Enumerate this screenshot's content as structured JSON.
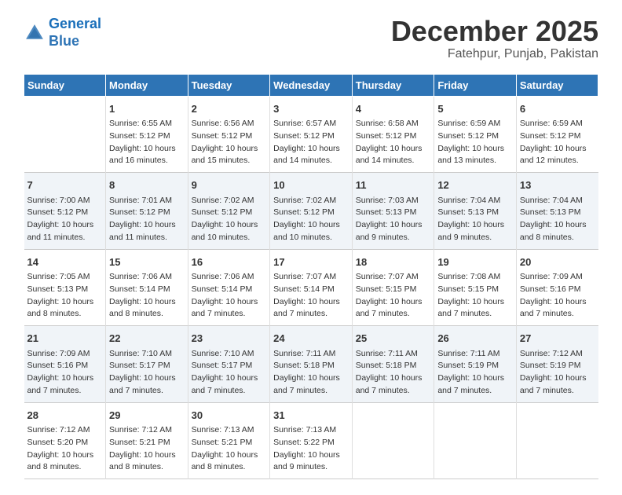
{
  "header": {
    "logo_line1": "General",
    "logo_line2": "Blue",
    "month": "December 2025",
    "location": "Fatehpur, Punjab, Pakistan"
  },
  "weekdays": [
    "Sunday",
    "Monday",
    "Tuesday",
    "Wednesday",
    "Thursday",
    "Friday",
    "Saturday"
  ],
  "weeks": [
    [
      {
        "day": "",
        "info": ""
      },
      {
        "day": "1",
        "info": "Sunrise: 6:55 AM\nSunset: 5:12 PM\nDaylight: 10 hours\nand 16 minutes."
      },
      {
        "day": "2",
        "info": "Sunrise: 6:56 AM\nSunset: 5:12 PM\nDaylight: 10 hours\nand 15 minutes."
      },
      {
        "day": "3",
        "info": "Sunrise: 6:57 AM\nSunset: 5:12 PM\nDaylight: 10 hours\nand 14 minutes."
      },
      {
        "day": "4",
        "info": "Sunrise: 6:58 AM\nSunset: 5:12 PM\nDaylight: 10 hours\nand 14 minutes."
      },
      {
        "day": "5",
        "info": "Sunrise: 6:59 AM\nSunset: 5:12 PM\nDaylight: 10 hours\nand 13 minutes."
      },
      {
        "day": "6",
        "info": "Sunrise: 6:59 AM\nSunset: 5:12 PM\nDaylight: 10 hours\nand 12 minutes."
      }
    ],
    [
      {
        "day": "7",
        "info": "Sunrise: 7:00 AM\nSunset: 5:12 PM\nDaylight: 10 hours\nand 11 minutes."
      },
      {
        "day": "8",
        "info": "Sunrise: 7:01 AM\nSunset: 5:12 PM\nDaylight: 10 hours\nand 11 minutes."
      },
      {
        "day": "9",
        "info": "Sunrise: 7:02 AM\nSunset: 5:12 PM\nDaylight: 10 hours\nand 10 minutes."
      },
      {
        "day": "10",
        "info": "Sunrise: 7:02 AM\nSunset: 5:12 PM\nDaylight: 10 hours\nand 10 minutes."
      },
      {
        "day": "11",
        "info": "Sunrise: 7:03 AM\nSunset: 5:13 PM\nDaylight: 10 hours\nand 9 minutes."
      },
      {
        "day": "12",
        "info": "Sunrise: 7:04 AM\nSunset: 5:13 PM\nDaylight: 10 hours\nand 9 minutes."
      },
      {
        "day": "13",
        "info": "Sunrise: 7:04 AM\nSunset: 5:13 PM\nDaylight: 10 hours\nand 8 minutes."
      }
    ],
    [
      {
        "day": "14",
        "info": "Sunrise: 7:05 AM\nSunset: 5:13 PM\nDaylight: 10 hours\nand 8 minutes."
      },
      {
        "day": "15",
        "info": "Sunrise: 7:06 AM\nSunset: 5:14 PM\nDaylight: 10 hours\nand 8 minutes."
      },
      {
        "day": "16",
        "info": "Sunrise: 7:06 AM\nSunset: 5:14 PM\nDaylight: 10 hours\nand 7 minutes."
      },
      {
        "day": "17",
        "info": "Sunrise: 7:07 AM\nSunset: 5:14 PM\nDaylight: 10 hours\nand 7 minutes."
      },
      {
        "day": "18",
        "info": "Sunrise: 7:07 AM\nSunset: 5:15 PM\nDaylight: 10 hours\nand 7 minutes."
      },
      {
        "day": "19",
        "info": "Sunrise: 7:08 AM\nSunset: 5:15 PM\nDaylight: 10 hours\nand 7 minutes."
      },
      {
        "day": "20",
        "info": "Sunrise: 7:09 AM\nSunset: 5:16 PM\nDaylight: 10 hours\nand 7 minutes."
      }
    ],
    [
      {
        "day": "21",
        "info": "Sunrise: 7:09 AM\nSunset: 5:16 PM\nDaylight: 10 hours\nand 7 minutes."
      },
      {
        "day": "22",
        "info": "Sunrise: 7:10 AM\nSunset: 5:17 PM\nDaylight: 10 hours\nand 7 minutes."
      },
      {
        "day": "23",
        "info": "Sunrise: 7:10 AM\nSunset: 5:17 PM\nDaylight: 10 hours\nand 7 minutes."
      },
      {
        "day": "24",
        "info": "Sunrise: 7:11 AM\nSunset: 5:18 PM\nDaylight: 10 hours\nand 7 minutes."
      },
      {
        "day": "25",
        "info": "Sunrise: 7:11 AM\nSunset: 5:18 PM\nDaylight: 10 hours\nand 7 minutes."
      },
      {
        "day": "26",
        "info": "Sunrise: 7:11 AM\nSunset: 5:19 PM\nDaylight: 10 hours\nand 7 minutes."
      },
      {
        "day": "27",
        "info": "Sunrise: 7:12 AM\nSunset: 5:19 PM\nDaylight: 10 hours\nand 7 minutes."
      }
    ],
    [
      {
        "day": "28",
        "info": "Sunrise: 7:12 AM\nSunset: 5:20 PM\nDaylight: 10 hours\nand 8 minutes."
      },
      {
        "day": "29",
        "info": "Sunrise: 7:12 AM\nSunset: 5:21 PM\nDaylight: 10 hours\nand 8 minutes."
      },
      {
        "day": "30",
        "info": "Sunrise: 7:13 AM\nSunset: 5:21 PM\nDaylight: 10 hours\nand 8 minutes."
      },
      {
        "day": "31",
        "info": "Sunrise: 7:13 AM\nSunset: 5:22 PM\nDaylight: 10 hours\nand 9 minutes."
      },
      {
        "day": "",
        "info": ""
      },
      {
        "day": "",
        "info": ""
      },
      {
        "day": "",
        "info": ""
      }
    ]
  ]
}
